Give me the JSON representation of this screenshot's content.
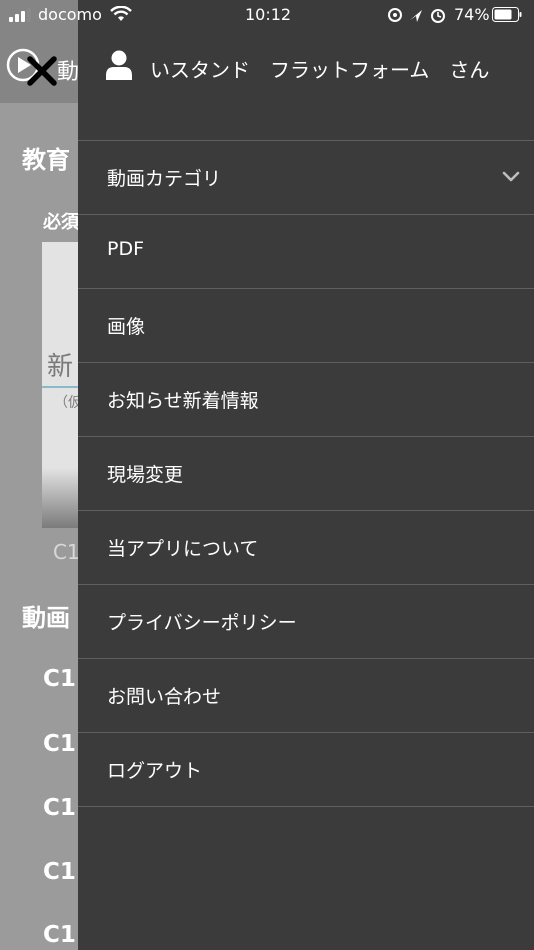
{
  "status_bar": {
    "carrier": "docomo",
    "time": "10:12",
    "battery_percent": "74%"
  },
  "background": {
    "header_text": "動",
    "section_title_1": "教育",
    "label": "必須",
    "card_text": "新",
    "card_subtext": "（仮",
    "caption": "C1",
    "section_title_2": "動画",
    "list_items": [
      "C1",
      "C1",
      "C1",
      "C1",
      "C1"
    ]
  },
  "drawer": {
    "user_name": "いスタンド　フラットフォーム　さん",
    "menu_items": [
      {
        "label": "動画カテゴリ",
        "has_submenu": true
      },
      {
        "label": "PDF"
      },
      {
        "label": "画像"
      },
      {
        "label": "お知らせ新着情報"
      },
      {
        "label": "現場変更"
      },
      {
        "label": "当アプリについて"
      },
      {
        "label": "プライバシーポリシー"
      },
      {
        "label": "お問い合わせ"
      },
      {
        "label": "ログアウト"
      }
    ]
  },
  "colors": {
    "drawer_background": "#3b3b3b",
    "divider": "#5f5f5f",
    "overlay_background": "#9b9b9b",
    "text": "#ffffff"
  },
  "icons": {
    "close": "close-icon",
    "user": "user-icon",
    "submenu": "chevron-down-icon",
    "play": "play-icon"
  }
}
